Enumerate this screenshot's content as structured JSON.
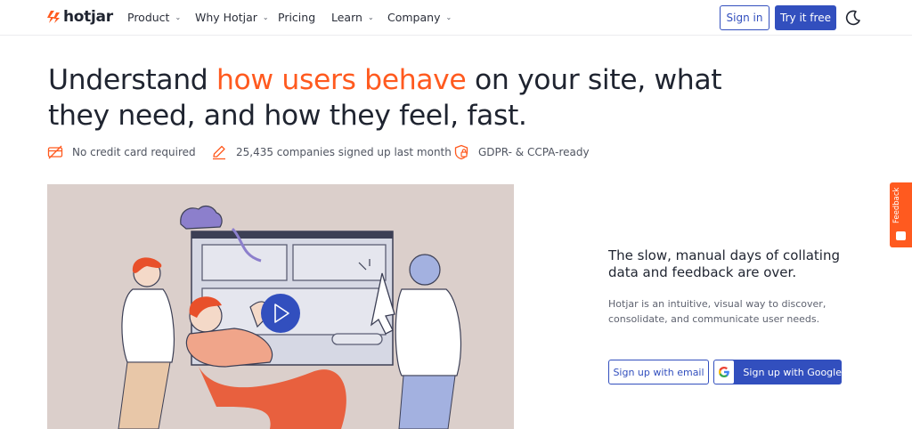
{
  "brand": {
    "name": "hotjar",
    "accent": "#ff5a1f",
    "primary": "#324fbe"
  },
  "nav": {
    "items": [
      {
        "label": "Product",
        "dropdown": true
      },
      {
        "label": "Why Hotjar",
        "dropdown": true
      },
      {
        "label": "Pricing",
        "dropdown": false
      },
      {
        "label": "Learn",
        "dropdown": true
      },
      {
        "label": "Company",
        "dropdown": true
      }
    ],
    "chevron": "⌄",
    "sign_in": "Sign in",
    "try_free": "Try it free",
    "theme_icon": "moon-icon"
  },
  "hero": {
    "headline_pre": "Understand ",
    "headline_accent": "how users behave",
    "headline_post": " on your site, what they need, and how they feel, fast.",
    "badges": [
      {
        "icon": "no-credit-card-icon",
        "text": "No credit card required"
      },
      {
        "icon": "pencil-sign-icon",
        "text": "25,435 companies signed up last month"
      },
      {
        "icon": "shield-lock-icon",
        "text": "GDPR- & CCPA-ready"
      }
    ],
    "video_icon": "play-icon"
  },
  "aside": {
    "subhead": "The slow, manual days of collating data and feedback are over.",
    "description": "Hotjar is an intuitive, visual way to discover, consolidate, and communicate user needs.",
    "signup_email": "Sign up with email",
    "signup_google": "Sign up with Google"
  },
  "feedback_tab": {
    "label": "Feedback"
  }
}
